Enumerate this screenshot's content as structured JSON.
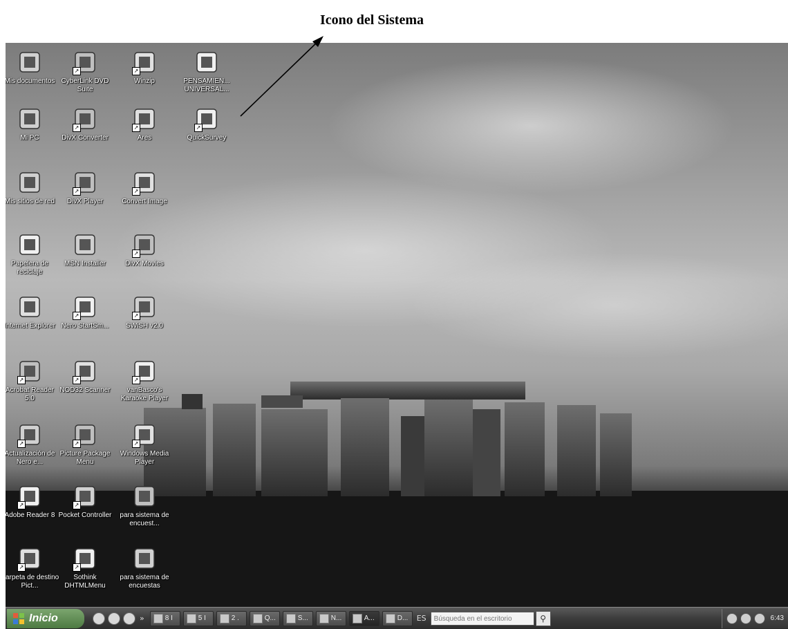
{
  "annotation": {
    "title": "Icono del Sistema"
  },
  "desktop": {
    "icons": [
      {
        "label": "Mis documentos",
        "icon": "folder-documents-icon",
        "shortcut": false
      },
      {
        "label": "CyberLink DVD Suite",
        "icon": "dvd-suite-icon",
        "shortcut": true
      },
      {
        "label": "Winzip",
        "icon": "winzip-icon",
        "shortcut": true
      },
      {
        "label": "PENSAMIEN... UNIVERSAL...",
        "icon": "document-icon",
        "shortcut": false
      },
      {
        "label": "Mi PC",
        "icon": "computer-icon",
        "shortcut": false
      },
      {
        "label": "DivX Converter",
        "icon": "divx-converter-icon",
        "shortcut": true
      },
      {
        "label": "Ares",
        "icon": "ares-icon",
        "shortcut": true
      },
      {
        "label": "QuickSurvey",
        "icon": "quicksurvey-chart-icon",
        "shortcut": true
      },
      {
        "label": "Mis sitios de red",
        "icon": "network-places-icon",
        "shortcut": false
      },
      {
        "label": "DivX Player",
        "icon": "divx-player-icon",
        "shortcut": true
      },
      {
        "label": "Convert Image",
        "icon": "convert-image-icon",
        "shortcut": true
      },
      {
        "label": "Papelera de reciclaje",
        "icon": "recycle-bin-icon",
        "shortcut": false
      },
      {
        "label": "MSN Installer",
        "icon": "msn-butterfly-icon",
        "shortcut": false
      },
      {
        "label": "DivX Movies",
        "icon": "divx-movies-icon",
        "shortcut": true
      },
      {
        "label": "Internet Explorer",
        "icon": "internet-explorer-icon",
        "shortcut": false
      },
      {
        "label": "Nero StartSm...",
        "icon": "nero-icon",
        "shortcut": true
      },
      {
        "label": "SWiSH v2.0",
        "icon": "swish-icon",
        "shortcut": true
      },
      {
        "label": "Acrobat Reader 5.0",
        "icon": "acrobat-reader-icon",
        "shortcut": true
      },
      {
        "label": "NOD32 Scanner",
        "icon": "nod32-scanner-icon",
        "shortcut": true
      },
      {
        "label": "vanBasco's Karaoke Player",
        "icon": "karaoke-player-icon",
        "shortcut": true
      },
      {
        "label": "Actualización de Nero e...",
        "icon": "nero-update-icon",
        "shortcut": true
      },
      {
        "label": "Picture Package Menu",
        "icon": "picture-package-icon",
        "shortcut": true
      },
      {
        "label": "Windows Media Player",
        "icon": "media-player-icon",
        "shortcut": true
      },
      {
        "label": "Adobe Reader 8",
        "icon": "adobe-reader-icon",
        "shortcut": true
      },
      {
        "label": "Pocket Controller",
        "icon": "pocket-controller-icon",
        "shortcut": true
      },
      {
        "label": "para sistema de encuest...",
        "icon": "survey-system-icon",
        "shortcut": false
      },
      {
        "label": "Carpeta de destino Pict...",
        "icon": "picture-folder-icon",
        "shortcut": true
      },
      {
        "label": "Sothink DHTMLMenu",
        "icon": "sothink-dhtmlmenu-icon",
        "shortcut": true
      },
      {
        "label": "para sistema de encuestas",
        "icon": "folder-icon",
        "shortcut": false
      }
    ]
  },
  "taskbar": {
    "start_label": "Inicio",
    "quick_launch_more": "»",
    "tasks": [
      {
        "label": "8 I",
        "icon": "folder-task-icon",
        "active": false
      },
      {
        "label": "5 I",
        "icon": "word-task-icon",
        "active": false
      },
      {
        "label": "2 .",
        "icon": "powerpoint-task-icon",
        "active": false
      },
      {
        "label": "Q...",
        "icon": "quicksurvey-task-icon",
        "active": false
      },
      {
        "label": "S...",
        "icon": "sothink-task-icon",
        "active": false
      },
      {
        "label": "N...",
        "icon": "nero-task-icon",
        "active": false
      },
      {
        "label": "A...",
        "icon": "app-task-icon",
        "active": true
      },
      {
        "label": "D...",
        "icon": "divx-task-icon",
        "active": false
      }
    ],
    "language": "ES",
    "search_placeholder": "Búsqueda en el escritorio",
    "search_icon": "magnifier-icon",
    "clock": "6:43"
  }
}
